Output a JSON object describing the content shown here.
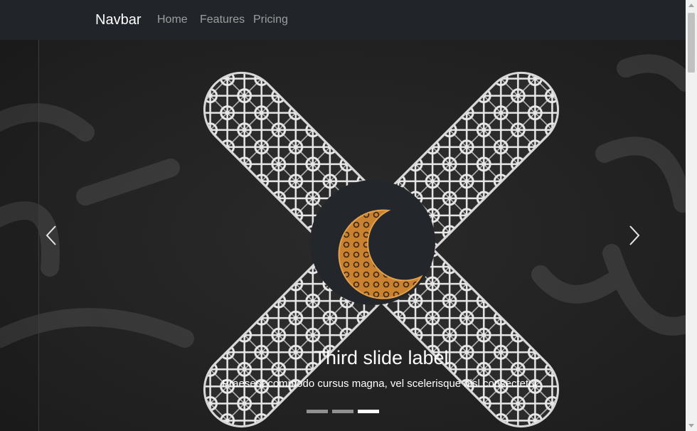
{
  "navbar": {
    "brand": "Navbar",
    "links": [
      "Home",
      "Features",
      "Pricing"
    ]
  },
  "carousel": {
    "caption_title": "Third slide label",
    "caption_text": "Praesent commodo cursus magna, vel scelerisque nisl consectetur.",
    "indicators": {
      "count": 3,
      "active": 3
    },
    "controls": {
      "prev_icon": "chevron-left-icon",
      "next_icon": "chevron-right-icon"
    },
    "image": "crescent-moon-cross-pattern"
  },
  "colors": {
    "navbar_bg": "#212529",
    "crescent": "#c9822f",
    "pattern": "#e8e8e8"
  }
}
